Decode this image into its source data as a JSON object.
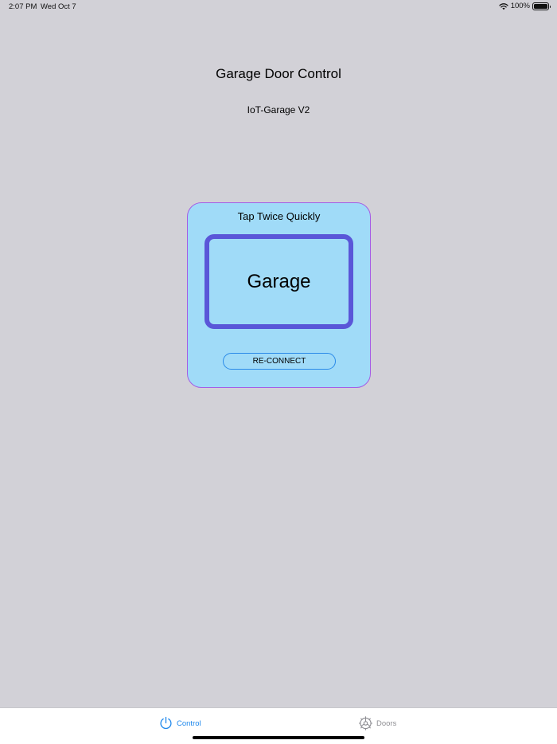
{
  "status_bar": {
    "time": "2:07 PM",
    "date": "Wed Oct 7",
    "battery": "100%",
    "icons": [
      "wifi-icon",
      "battery-icon"
    ]
  },
  "header": {
    "title": "Garage Door Control",
    "subtitle": "IoT-Garage V2"
  },
  "control_card": {
    "hint": "Tap Twice Quickly",
    "garage_label": "Garage",
    "reconnect_label": "RE-CONNECT"
  },
  "tab_bar": {
    "tabs": [
      {
        "label": "Control",
        "icon": "power-icon",
        "selected": true
      },
      {
        "label": "Doors",
        "icon": "gear-icon",
        "selected": false
      }
    ]
  },
  "colors": {
    "background": "#d2d1d7",
    "card_fill": "#a0dbf8",
    "card_border": "#a45de6",
    "garage_border": "#5a56d8",
    "accent": "#1f88ec",
    "inactive_tab": "#8e8e93"
  }
}
